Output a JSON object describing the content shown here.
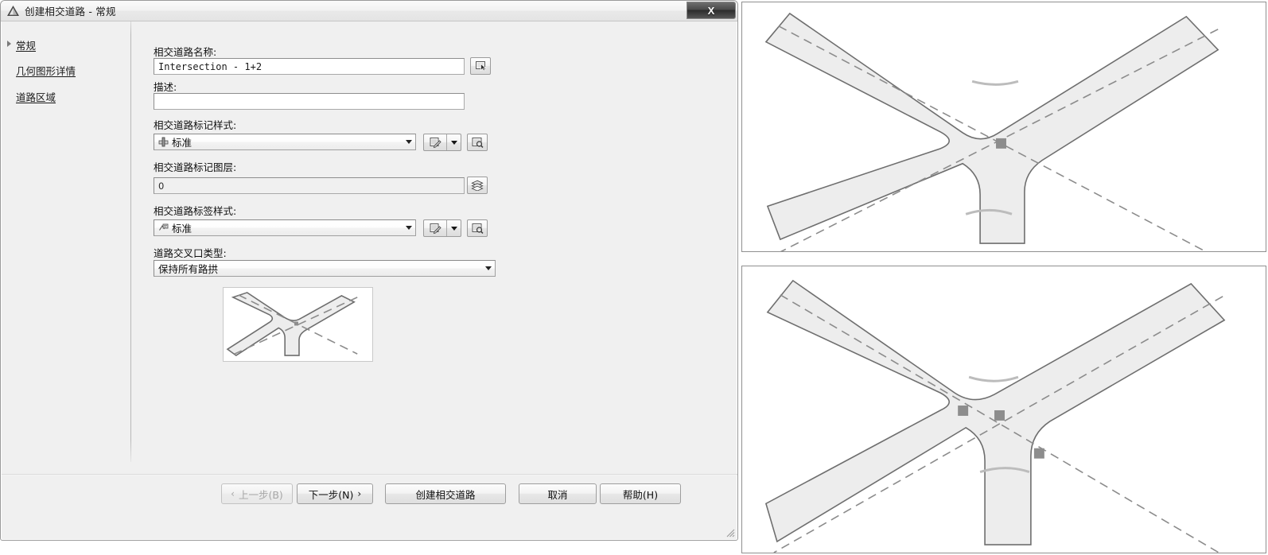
{
  "dialog": {
    "title": "创建相交道路 - 常规",
    "logo_icon": "autocad-triangle-icon",
    "close_label": "X"
  },
  "sidebar": {
    "items": [
      {
        "label": "常规",
        "selected": true
      },
      {
        "label": "几何图形详情",
        "selected": false
      },
      {
        "label": "道路区域",
        "selected": false
      }
    ]
  },
  "form": {
    "name": {
      "label": "相交道路名称:",
      "value": "Intersection - 1+2",
      "picker_icon": "pick-on-screen-icon"
    },
    "description": {
      "label": "描述:",
      "value": "",
      "placeholder": ""
    },
    "marker_style": {
      "label": "相交道路标记样式:",
      "value": "标准",
      "value_icon": "marker-style-icon",
      "edit_icon": "edit-style-icon",
      "dropdown_icon": "chevron-down-icon",
      "preview_icon": "preview-style-icon"
    },
    "marker_layer": {
      "label": "相交道路标记图层:",
      "value": "0",
      "layer_icon": "layers-icon"
    },
    "label_style": {
      "label": "相交道路标签样式:",
      "value": "标准",
      "value_icon": "label-style-icon",
      "edit_icon": "edit-style-icon",
      "dropdown_icon": "chevron-down-icon",
      "preview_icon": "preview-style-icon"
    },
    "intersection_type": {
      "label": "道路交叉口类型:",
      "value": "保持所有路拱",
      "dropdown_icon": "chevron-down-icon"
    },
    "preview": {
      "name": "intersection-type-preview",
      "alt": "X 形交叉口预览图"
    }
  },
  "footer": {
    "back": {
      "label": "上一步(B)",
      "chevron": "‹",
      "disabled": true
    },
    "next": {
      "label": "下一步(N)",
      "chevron": "›",
      "disabled": false
    },
    "create": {
      "label": "创建相交道路"
    },
    "cancel": {
      "label": "取消"
    },
    "help": {
      "label": "帮助(H)"
    },
    "resize_grip_icon": "resize-grip-icon"
  },
  "viewports": {
    "top": {
      "name": "drawing-viewport-top",
      "alt": "相交道路三维视图 - 单交点"
    },
    "bottom": {
      "name": "drawing-viewport-bottom",
      "alt": "相交道路三维视图 - 多交点"
    }
  },
  "colors": {
    "dialog_bg": "#f0f0f0",
    "titlebar_bg": "#f2f2f2",
    "close_btn": "#3a3a3a",
    "field_border": "#a0a0a0",
    "road_fill": "#ededed",
    "road_stroke": "#6e6e6e",
    "node": "#8d8d8d"
  }
}
